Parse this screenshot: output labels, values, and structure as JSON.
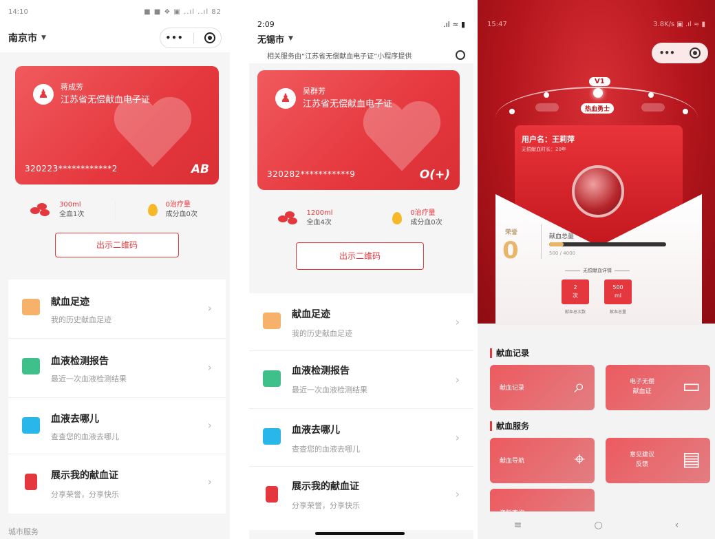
{
  "screen1": {
    "status_time": "14:10",
    "status_right": "■ ■ ❖ ▣ ..ıl ..ıl 82",
    "city": "南京市",
    "card": {
      "holder": "蒋成芳",
      "cert_name": "江苏省无偿献血电子证",
      "id_number": "320223************2",
      "blood_type": "AB"
    },
    "stats": {
      "whole_amount": "300ml",
      "whole_count": "全血1次",
      "component_amount": "0治疗量",
      "component_count": "成分血0次"
    },
    "qr_button": "出示二维码",
    "menu": [
      {
        "title": "献血足迹",
        "subtitle": "我的历史献血足迹"
      },
      {
        "title": "血液检测报告",
        "subtitle": "最近一次血液检测结果"
      },
      {
        "title": "血液去哪儿",
        "subtitle": "查查您的血液去哪儿"
      },
      {
        "title": "展示我的献血证",
        "subtitle": "分享荣誉，分享快乐"
      }
    ],
    "bottom_section": "城市服务"
  },
  "screen2": {
    "status_time": "2:09",
    "status_right": ".ıl ≈ ▮",
    "city": "无锡市",
    "hint": "相关服务由“江苏省无偿献血电子证”小程序提供",
    "card": {
      "holder": "吴群芳",
      "cert_name": "江苏省无偿献血电子证",
      "id_number": "320282***********9",
      "blood_type": "O(+)"
    },
    "stats": {
      "whole_amount": "1200ml",
      "whole_count": "全血4次",
      "component_amount": "0治疗量",
      "component_count": "成分血0次"
    },
    "qr_button": "出示二维码",
    "menu": [
      {
        "title": "献血足迹",
        "subtitle": "我的历史献血足迹"
      },
      {
        "title": "血液检测报告",
        "subtitle": "最近一次血液检测结果"
      },
      {
        "title": "血液去哪儿",
        "subtitle": "查查您的血液去哪儿"
      },
      {
        "title": "展示我的献血证",
        "subtitle": "分享荣誉，分享快乐"
      }
    ]
  },
  "screen3": {
    "status_time": "15:47",
    "status_right": "3.8K/s ▣ .ıl ≈ ▮",
    "level_current": "V1",
    "level_title": "热血勇士",
    "user_name": "用户名：王莉萍",
    "years_label": "无偿献血时长：20年",
    "honor_label": "荣誉",
    "honor_value": "0",
    "total_label": "献血总量",
    "progress_text": "500 / 4000",
    "progress_fraction": 0.125,
    "detail_label": "无偿献血详情",
    "count_value": "2",
    "count_unit": "次",
    "count_label": "献血总次数",
    "volume_value": "500",
    "volume_unit": "ml",
    "volume_label": "献血总量",
    "section_records": "献血记录",
    "section_services": "献血服务",
    "tiles": {
      "records": "献血记录",
      "e_cert_line1": "电子无偿",
      "e_cert_line2": "献血证",
      "nav": "献血导航",
      "feedback_line1": "意见建议",
      "feedback_line2": "反馈",
      "query": "资料查询"
    }
  }
}
